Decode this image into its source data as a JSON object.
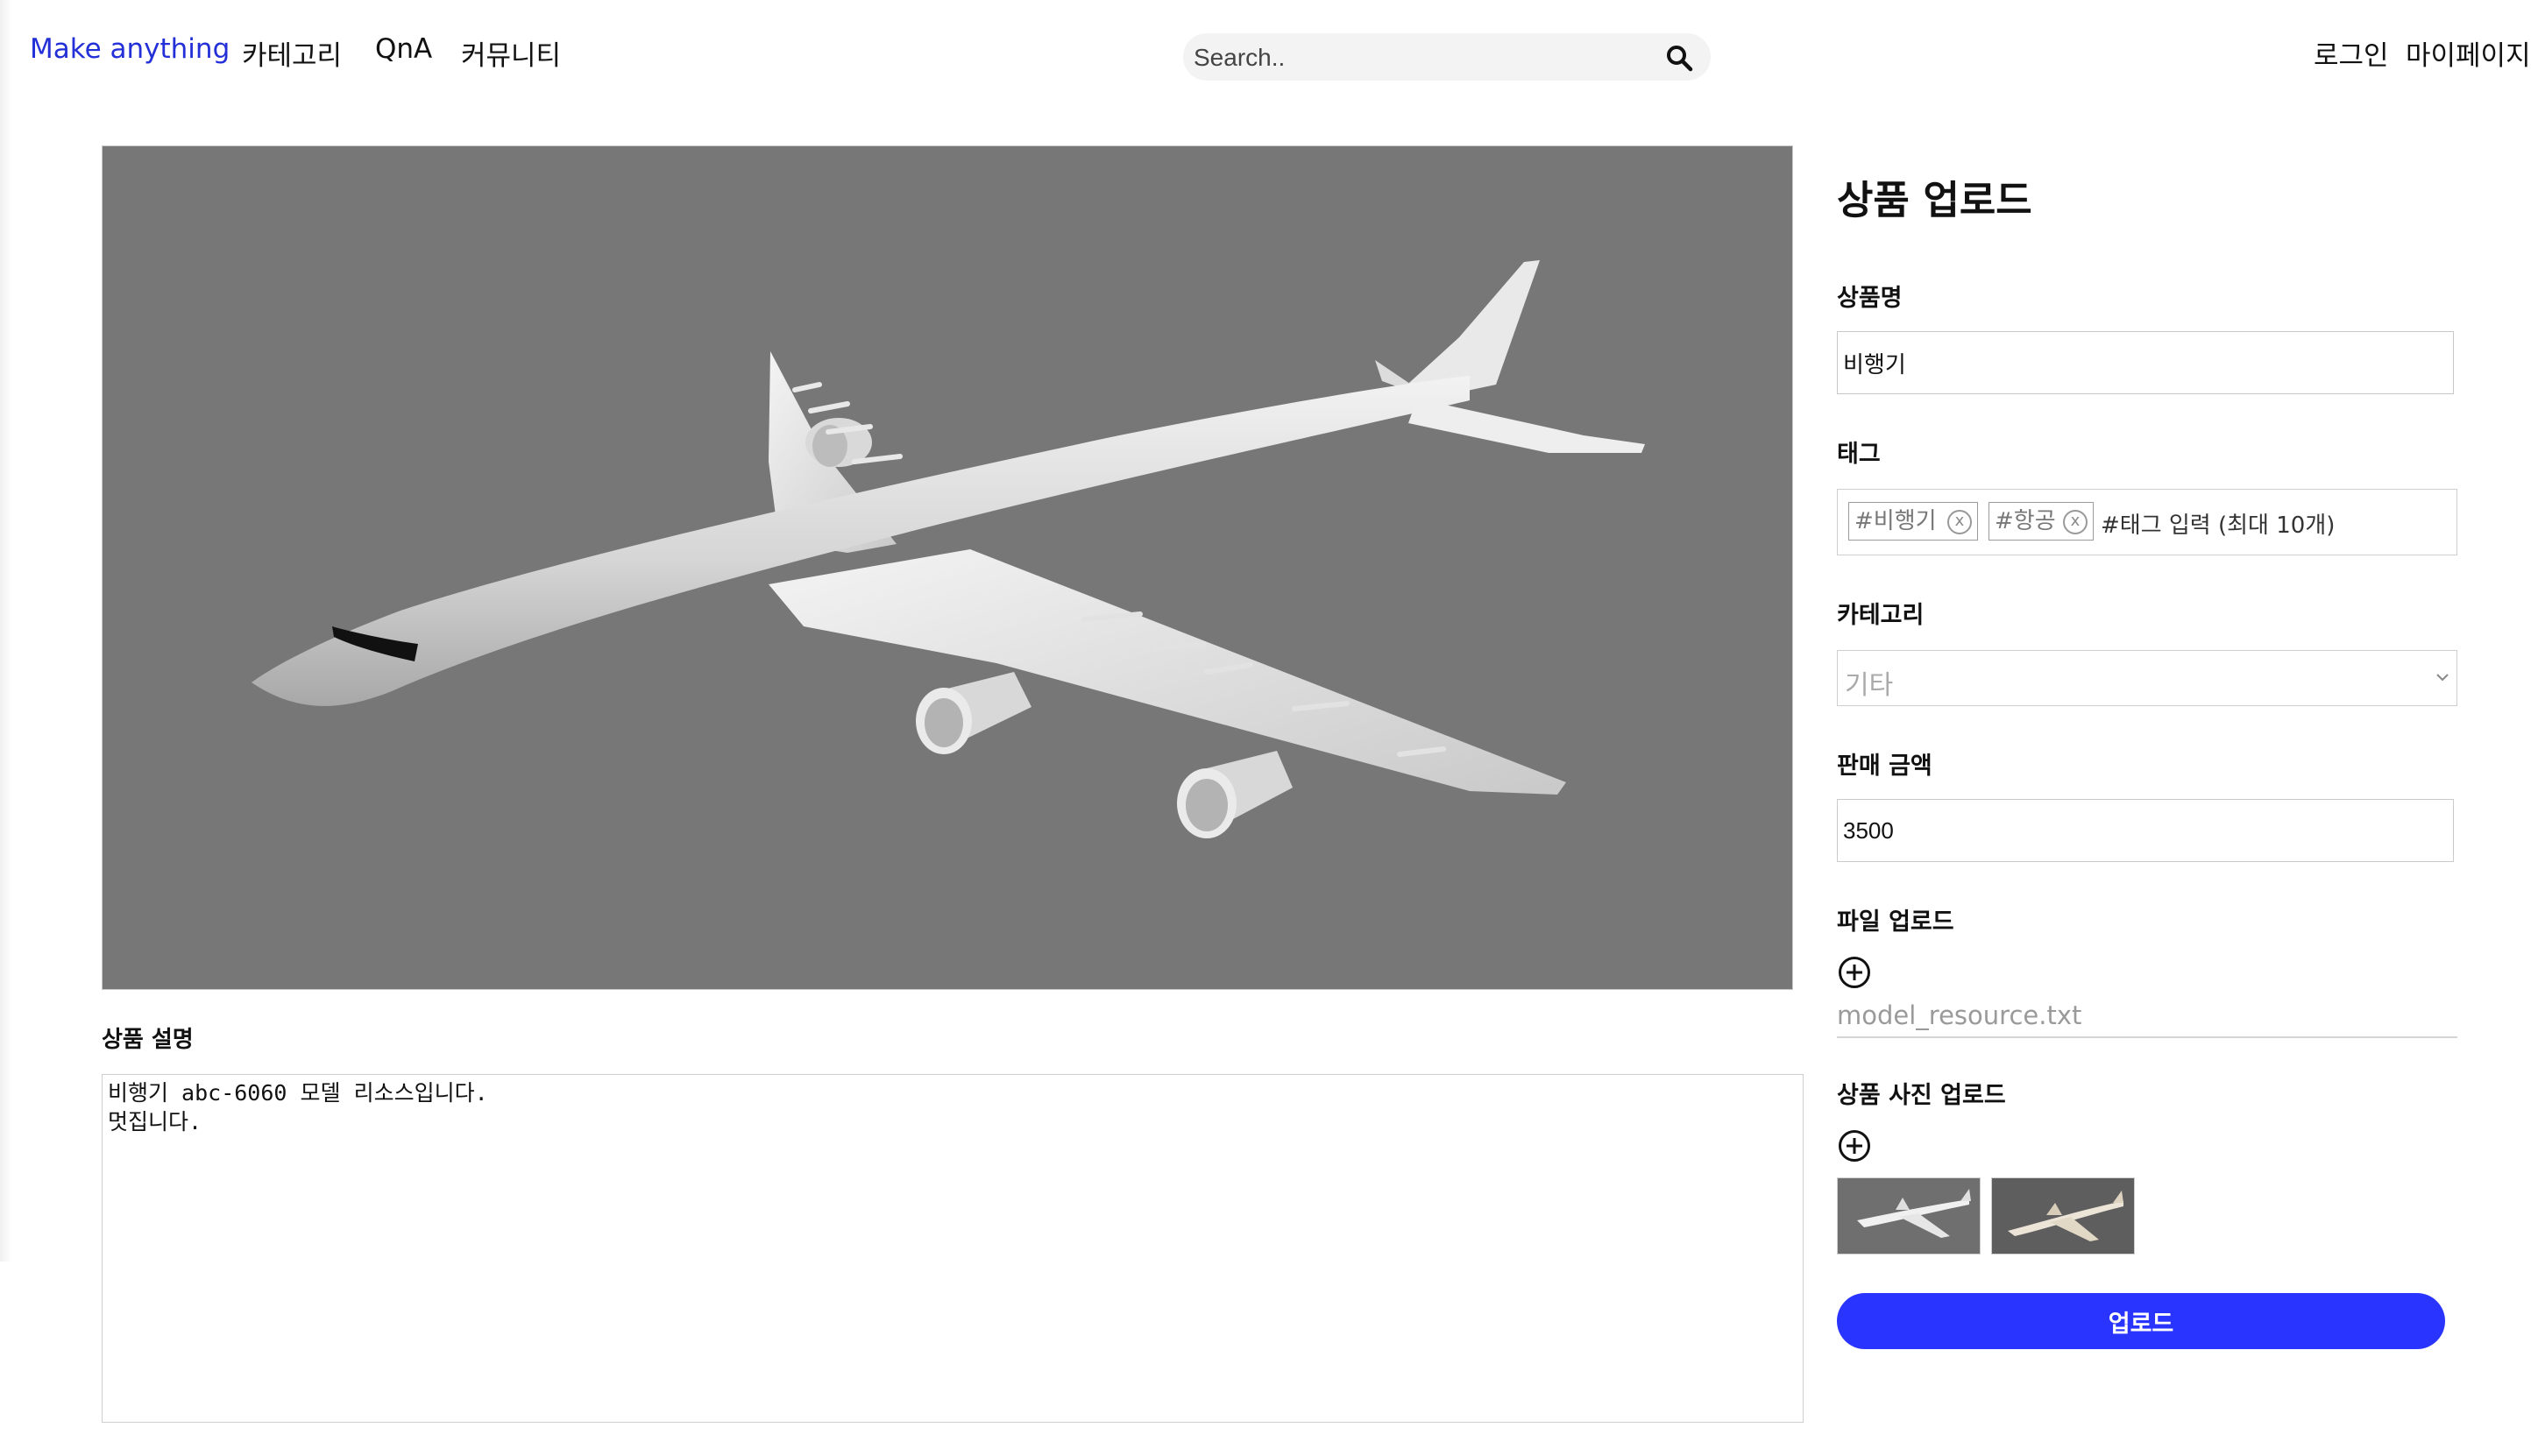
{
  "header": {
    "brand": "Make anything",
    "nav": [
      "카테고리",
      "QnA",
      "커뮤니티"
    ],
    "search_placeholder": "Search..",
    "login": "로그인",
    "mypage": "마이페이지"
  },
  "preview": {
    "alt": "airplane 3D model preview",
    "bg_color": "#777777"
  },
  "description": {
    "label": "상품 설명",
    "text": "비행기 abc-6060 모델 리소스입니다.\n멋집니다."
  },
  "form": {
    "title": "상품 업로드",
    "name_label": "상품명",
    "name_value": "비행기",
    "tag_label": "태그",
    "tags": [
      "#비행기",
      "#항공"
    ],
    "tag_placeholder": "#태그 입력 (최대 10개)",
    "category_label": "카테고리",
    "category_value": "기타",
    "price_label": "판매 금액",
    "price_value": "3500",
    "file_label": "파일 업로드",
    "file_name": "model_resource.txt",
    "photo_label": "상품 사진 업로드",
    "submit_label": "업로드"
  },
  "colors": {
    "brand": "#2330d8",
    "button": "#2a34ff"
  }
}
